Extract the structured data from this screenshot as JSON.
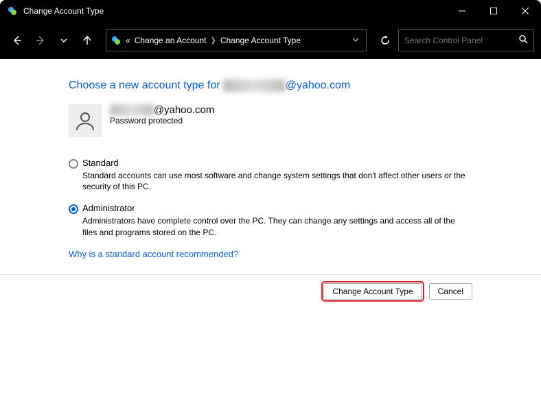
{
  "window": {
    "title": "Change Account Type"
  },
  "breadcrumb": {
    "prefix": "«",
    "items": [
      "Change an Account",
      "Change Account Type"
    ]
  },
  "search": {
    "placeholder": "Search Control Panel"
  },
  "heading": {
    "before": "Choose a new account type for ",
    "redacted": "████████",
    "after": "@yahoo.com"
  },
  "account": {
    "name_redacted": "██████",
    "name_suffix": "@yahoo.com",
    "subtext": "Password protected"
  },
  "options": {
    "standard": {
      "label": "Standard",
      "desc": "Standard accounts can use most software and change system settings that don't affect other users or the security of this PC.",
      "selected": false
    },
    "admin": {
      "label": "Administrator",
      "desc": "Administrators have complete control over the PC. They can change any settings and access all of the files and programs stored on the PC.",
      "selected": true
    }
  },
  "link": "Why is a standard account recommended?",
  "buttons": {
    "change": "Change Account Type",
    "cancel": "Cancel"
  }
}
